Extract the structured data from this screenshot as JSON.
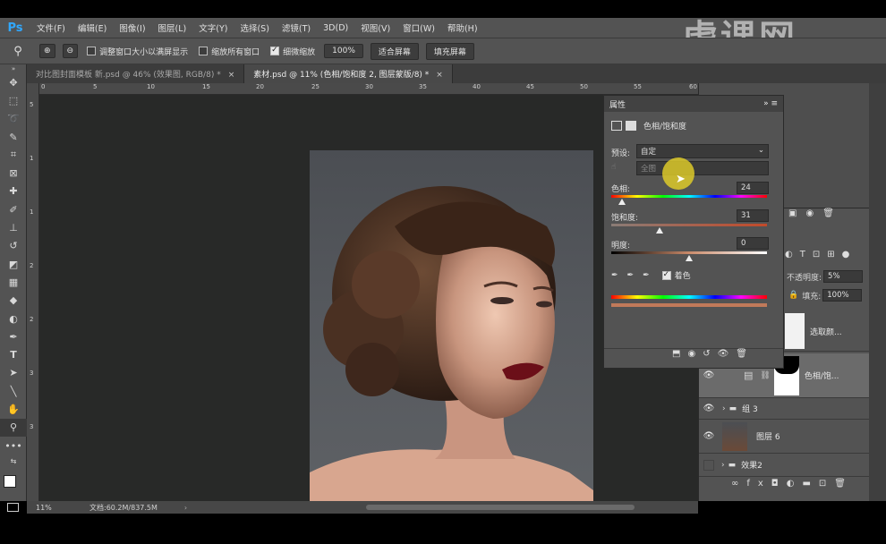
{
  "app": {
    "logo": "Ps",
    "menus": [
      "文件(F)",
      "编辑(E)",
      "图像(I)",
      "图层(L)",
      "文字(Y)",
      "选择(S)",
      "滤镜(T)",
      "3D(D)",
      "视图(V)",
      "窗口(W)",
      "帮助(H)"
    ],
    "watermark": "虎课网"
  },
  "options": {
    "resize_window_label": "调整窗口大小以满屏显示",
    "zoom_all_label": "缩放所有窗口",
    "scrubby_zoom_label": "细微缩放",
    "zoom_100": "100%",
    "fit_screen": "适合屏幕",
    "fill_screen": "填充屏幕"
  },
  "tabs": [
    {
      "label": "对比图封面模板 新.psd @ 46% (效果图, RGB/8) *",
      "close": "×"
    },
    {
      "label": "素材.psd @ 11% (色相/饱和度 2, 图层蒙版/8) *",
      "close": "×"
    }
  ],
  "ruler": {
    "h_ticks": [
      "0",
      "5",
      "10",
      "15",
      "20",
      "25",
      "30",
      "35",
      "40",
      "45",
      "50",
      "55",
      "60"
    ],
    "v_ticks": [
      "5",
      "1",
      "1",
      "2",
      "2",
      "3",
      "3"
    ]
  },
  "status": {
    "zoom": "11%",
    "doc": "文档:60.2M/837.5M",
    "arrow": "›"
  },
  "properties": {
    "title": "属性",
    "adjustment_name": "色相/饱和度",
    "preset_label": "预设:",
    "preset_value": "自定",
    "channel_value": "全图",
    "hue_label": "色相:",
    "hue_value": "24",
    "hue": 24,
    "saturation_label": "饱和度:",
    "saturation_value": "31",
    "saturation": 31,
    "lightness_label": "明度:",
    "lightness_value": "0",
    "lightness": 0,
    "colorize_label": "着色"
  },
  "layers_panel": {
    "opacity_label": "不透明度:",
    "opacity_value": "5%",
    "fill_label": "填充:",
    "fill_value": "100%",
    "items": [
      {
        "name": "选取颜..."
      },
      {
        "name": "色相/饱..."
      },
      {
        "name": "组 3"
      },
      {
        "name": "图层 6"
      },
      {
        "name": "效果2"
      }
    ]
  },
  "colors": {
    "menubar": "#535353",
    "canvas_bg": "#282928",
    "ps_blue": "#31a8ff"
  }
}
